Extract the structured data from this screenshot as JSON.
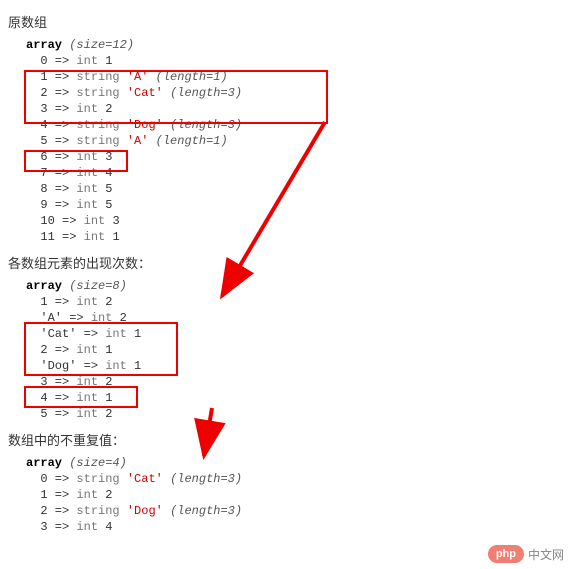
{
  "section1": {
    "title": "原数组",
    "size": 12,
    "rows": [
      {
        "k": "0",
        "t": "int",
        "v": "1"
      },
      {
        "k": "1",
        "t": "string",
        "v": "'A'",
        "len": 1
      },
      {
        "k": "2",
        "t": "string",
        "v": "'Cat'",
        "len": 3
      },
      {
        "k": "3",
        "t": "int",
        "v": "2"
      },
      {
        "k": "4",
        "t": "string",
        "v": "'Dog'",
        "len": 3
      },
      {
        "k": "5",
        "t": "string",
        "v": "'A'",
        "len": 1
      },
      {
        "k": "6",
        "t": "int",
        "v": "3"
      },
      {
        "k": "7",
        "t": "int",
        "v": "4"
      },
      {
        "k": "8",
        "t": "int",
        "v": "5"
      },
      {
        "k": "9",
        "t": "int",
        "v": "5"
      },
      {
        "k": "10",
        "t": "int",
        "v": "3"
      },
      {
        "k": "11",
        "t": "int",
        "v": "1"
      }
    ]
  },
  "section2": {
    "title": "各数组元素的出现次数：",
    "size": 8,
    "rows": [
      {
        "k": "1",
        "t": "int",
        "v": "2"
      },
      {
        "k": "'A'",
        "t": "int",
        "v": "2"
      },
      {
        "k": "'Cat'",
        "t": "int",
        "v": "1"
      },
      {
        "k": "2",
        "t": "int",
        "v": "1"
      },
      {
        "k": "'Dog'",
        "t": "int",
        "v": "1"
      },
      {
        "k": "3",
        "t": "int",
        "v": "2"
      },
      {
        "k": "4",
        "t": "int",
        "v": "1"
      },
      {
        "k": "5",
        "t": "int",
        "v": "2"
      }
    ]
  },
  "section3": {
    "title": "数组中的不重复值：",
    "size": 4,
    "rows": [
      {
        "k": "0",
        "t": "string",
        "v": "'Cat'",
        "len": 3
      },
      {
        "k": "1",
        "t": "int",
        "v": "2"
      },
      {
        "k": "2",
        "t": "string",
        "v": "'Dog'",
        "len": 3
      },
      {
        "k": "3",
        "t": "int",
        "v": "4"
      }
    ]
  },
  "labels": {
    "array": "array",
    "size_prefix": "(size=",
    "arrow": " => ",
    "len_prefix": "(length=",
    "close": ")"
  },
  "brand": {
    "pill": "php",
    "text": "中文网"
  }
}
